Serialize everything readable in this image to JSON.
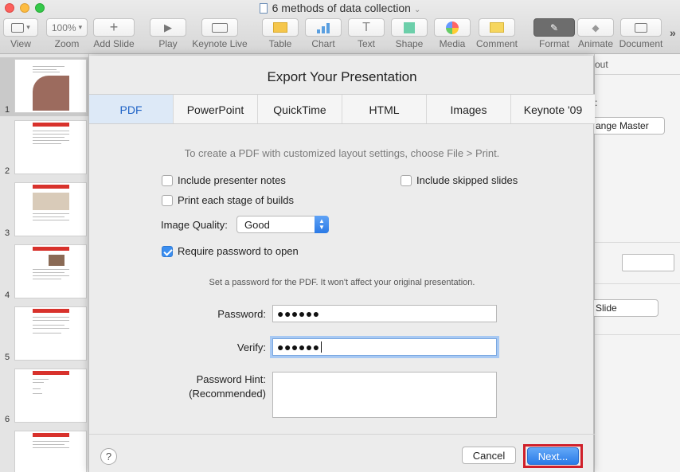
{
  "window": {
    "title": "6 methods of data collection"
  },
  "toolbar": {
    "view": "View",
    "zoom_value": "100%",
    "zoom": "Zoom",
    "add_slide": "Add Slide",
    "play": "Play",
    "keynote_live": "Keynote Live",
    "table": "Table",
    "chart": "Chart",
    "text": "Text",
    "shape": "Shape",
    "media": "Media",
    "comment": "Comment",
    "format": "Format",
    "animate": "Animate",
    "document": "Document",
    "more": "»"
  },
  "navigator": {
    "slides": [
      "1",
      "2",
      "3",
      "4",
      "5",
      "6"
    ]
  },
  "inspector": {
    "tab_fragment": "out",
    "change_master": "ange Master",
    "slide_button": "Slide"
  },
  "dialog": {
    "title": "Export Your Presentation",
    "tabs": [
      "PDF",
      "PowerPoint",
      "QuickTime",
      "HTML",
      "Images",
      "Keynote '09"
    ],
    "active_tab": "PDF",
    "info": "To create a PDF with customized layout settings, choose File > Print.",
    "options": {
      "presenter_notes": "Include presenter notes",
      "skipped_slides": "Include skipped slides",
      "print_builds": "Print each stage of builds",
      "require_password": "Require password to open"
    },
    "image_quality_label": "Image Quality:",
    "image_quality_value": "Good",
    "password_note": "Set a password for the PDF. It won't affect your original presentation.",
    "password_label": "Password:",
    "password_value": "●●●●●●",
    "verify_label": "Verify:",
    "verify_value": "●●●●●●",
    "hint_label_line1": "Password Hint:",
    "hint_label_line2": "(Recommended)",
    "help": "?",
    "cancel": "Cancel",
    "next": "Next..."
  },
  "colors": {
    "accent_blue": "#2a7be8",
    "highlight_red": "#d0202a",
    "tab_active_text": "#1f63c6"
  }
}
